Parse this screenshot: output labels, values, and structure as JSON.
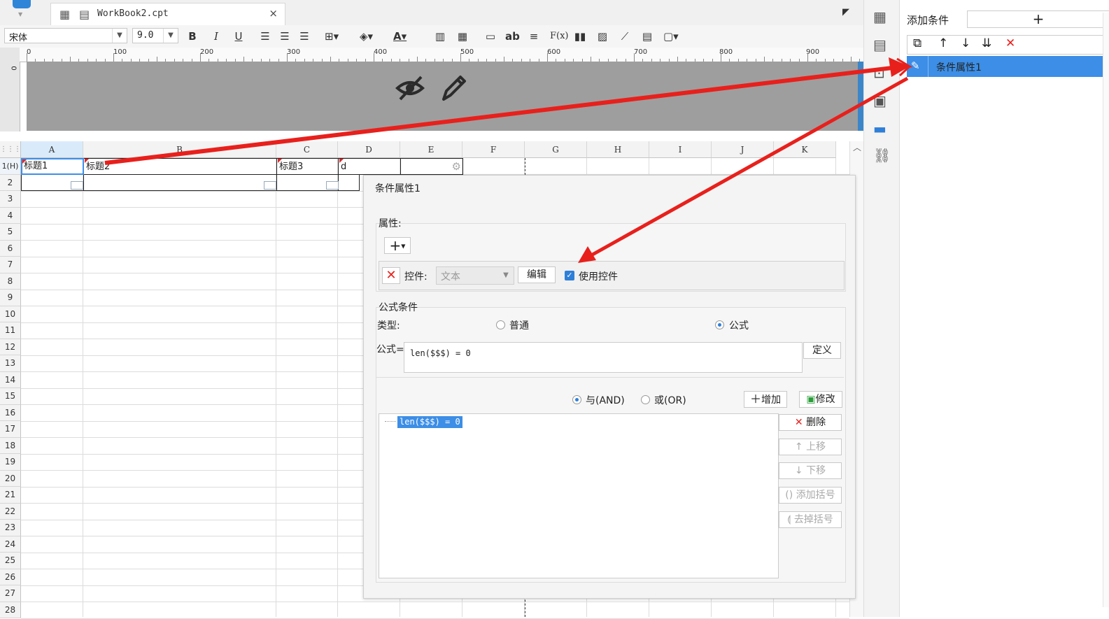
{
  "tab": {
    "title": "WorkBook2.cpt",
    "close": "×"
  },
  "toolbar": {
    "font": "宋体",
    "size": "9.0",
    "bold": "B",
    "italic": "I",
    "underline": "U",
    "text_ab": "ab",
    "formula": "F(x)"
  },
  "ruler": {
    "marks": [
      "0",
      "100",
      "200",
      "300",
      "400",
      "500",
      "600",
      "700",
      "800",
      "900"
    ]
  },
  "grid": {
    "columns": [
      "A",
      "B",
      "C",
      "D",
      "E",
      "F",
      "G",
      "H",
      "I",
      "J",
      "K"
    ],
    "rows": [
      "1(H)",
      "2",
      "3",
      "4",
      "5",
      "6",
      "7",
      "8",
      "9",
      "10",
      "11",
      "12",
      "13",
      "14",
      "15",
      "16",
      "17",
      "18",
      "19",
      "20",
      "21",
      "22",
      "23",
      "24",
      "25",
      "26",
      "27",
      "28"
    ],
    "row1": {
      "A": "标题1",
      "B": "标题2",
      "C": "标题3",
      "D": "d"
    }
  },
  "right_panel": {
    "title": "添加条件",
    "add": "+",
    "item": "条件属性1"
  },
  "dialog": {
    "title": "条件属性1",
    "property_label": "属性:",
    "add": "+",
    "control_label": "控件:",
    "control_value": "文本",
    "edit_button": "编辑",
    "use_control": "使用控件",
    "formula_section": "公式条件",
    "type_label": "类型:",
    "type_normal": "普通",
    "type_formula": "公式",
    "formula_label": "公式=",
    "formula_value": "len($$$) = 0",
    "define_button": "定义",
    "and_label": "与(AND)",
    "or_label": "或(OR)",
    "add_button": "增加",
    "modify_button": "修改",
    "list_item": "len($$$) = 0",
    "delete_button": "删除",
    "up_button": "上移",
    "down_button": "下移",
    "add_bracket": "添加括号",
    "remove_bracket": "去掉括号"
  },
  "colors": {
    "accent": "#3c8ee6",
    "arrow": "#e8201c"
  }
}
